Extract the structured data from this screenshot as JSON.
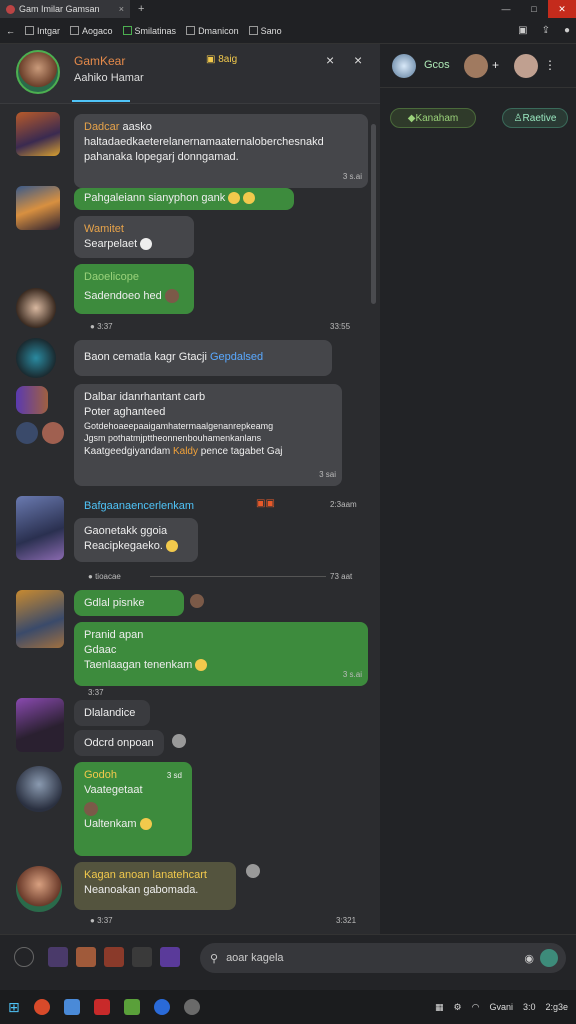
{
  "browser": {
    "tab_title": "Gam Imilar Gamsan",
    "tab_close": "×",
    "new_tab": "+",
    "win_min": "—",
    "win_max": "□",
    "win_close": "✕"
  },
  "bookmarks": [
    {
      "label": "Intgar"
    },
    {
      "label": "Aogaco"
    },
    {
      "label": "Smilatinas"
    },
    {
      "label": "Dmanicon"
    },
    {
      "label": "Sano"
    }
  ],
  "chat_header": {
    "name": "GamKear",
    "subtitle": "Aahiko Hamar",
    "badge": "8aig",
    "close1": "×",
    "close2": "×"
  },
  "messages": [
    {
      "name": "Dadcar",
      "name_extra": "aasko",
      "line1": "haltadaedkaeterelanernamaaternaloberchesnakd",
      "line2": "pahanaka lopegarj donngamad.",
      "time": "3 s.ai"
    },
    {
      "text": "Pahgaleiann sianyphon gank"
    },
    {
      "name": "Wamitet",
      "text": "Searpelaet"
    },
    {
      "name": "Daoelicope",
      "text": "Sadendoeo hed"
    },
    {
      "time_left": "3:37",
      "time_right": "33:55"
    },
    {
      "text": "Baon cematla kagr Gtacji",
      "link": "Gepdalsed"
    },
    {
      "line1": "Dalbar idanrhantant carb",
      "line2": "Poter aghanteed",
      "line3": "Gotdehoaeepaaigamhatermaalgenanrepkeamg",
      "line4": "Jgsm pothatmjpttheonnenbouhamenkanlans",
      "line5": "Kaatgeedgiyandam",
      "hl": "Kaldy",
      "line5b": "pence tagabet Gaj",
      "time": "3 sai"
    },
    {
      "name": "Bafgaanaencerlenkam",
      "time": "2:3aam"
    },
    {
      "line1": "Gaonetakk ggoia",
      "line2": "Reacipkegaeko."
    },
    {
      "sep_text": "tioacae",
      "sep_time": "73 aat"
    },
    {
      "text": "Gdlal pisnke"
    },
    {
      "line1": "Pranid apan",
      "line2": "Gdaac",
      "line3": "Taenlaagan tenenkam",
      "time": "3 s.ai"
    },
    {
      "time": "3:37"
    },
    {
      "text": "Dlalandice"
    },
    {
      "text": "Odcrd onpoan"
    },
    {
      "name": "Godoh",
      "tag": "3 sd",
      "line2": "Vaategetaat",
      "line3": "Ualtenkam"
    },
    {
      "name": "Kagan anoan lanatehcart",
      "line2": "Neanoakan gabomada."
    },
    {
      "time_left": "3:37",
      "time_right": "3:321"
    }
  ],
  "right_panel": {
    "name": "Gcos",
    "pill1": "Kanaham",
    "pill2": "Raetive"
  },
  "composer": {
    "placeholder": "aoar kagela"
  },
  "taskbar": {
    "label1": "Gvani",
    "label2": "3:0",
    "label3": "2:g3e"
  },
  "colors": {
    "accent_green": "#3d8b3d",
    "accent_blue": "#4fc3f7",
    "name_orange": "#e7a34a"
  }
}
